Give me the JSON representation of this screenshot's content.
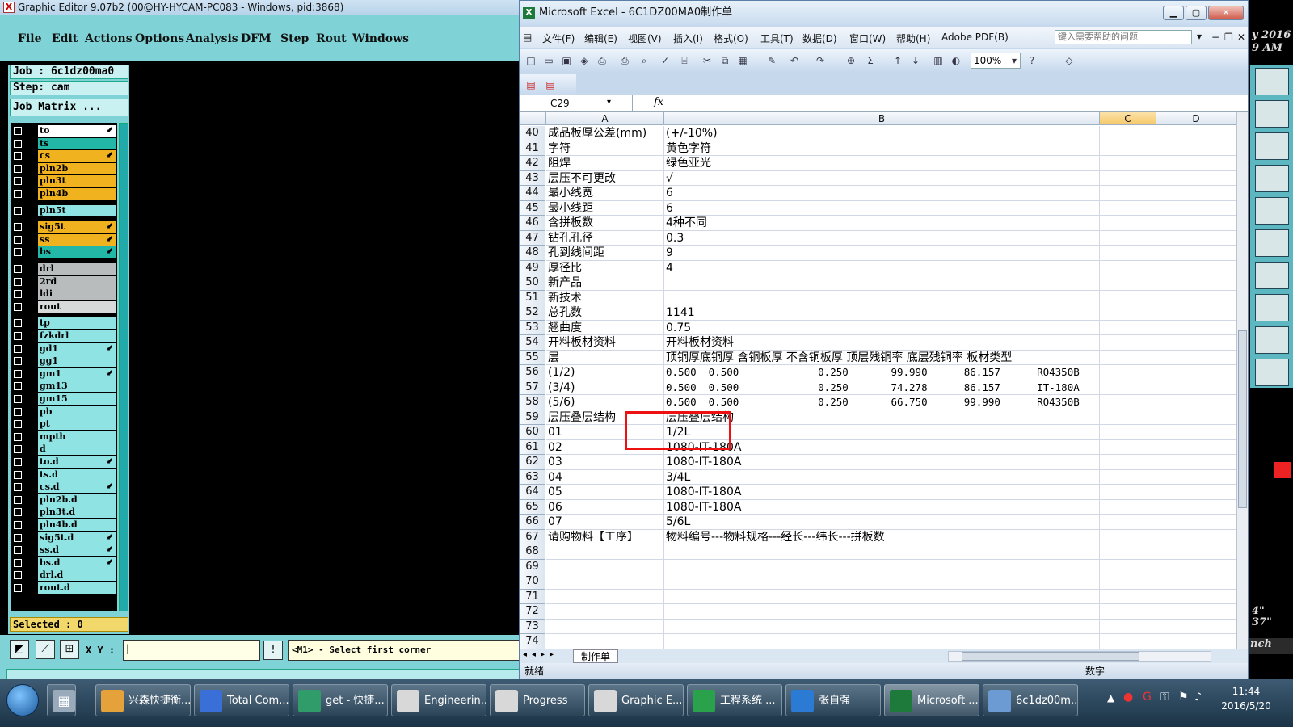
{
  "graphic_editor": {
    "title": "Graphic Editor 9.07b2 (00@HY-HYCAM-PC083 - Windows, pid:3868)",
    "menu": [
      "File",
      "Edit",
      "Actions",
      "Options",
      "Analysis",
      "DFM",
      "Step",
      "Rout",
      "Windows"
    ],
    "job": "Job : 6c1dz00ma0",
    "step": "Step: cam",
    "job_matrix": "Job Matrix ...",
    "layers": [
      {
        "name": "to",
        "color": "#ffffff",
        "arrow": true
      },
      {
        "name": "ts",
        "color": "#23b7a8",
        "arrow": false
      },
      {
        "name": "cs",
        "color": "#f0b21f",
        "arrow": true
      },
      {
        "name": "pln2b",
        "color": "#f0b21f",
        "arrow": false
      },
      {
        "name": "pln3t",
        "color": "#f0b21f",
        "arrow": false
      },
      {
        "name": "pln4b",
        "color": "#f0b21f",
        "arrow": false
      },
      {
        "name": "pln5t",
        "color": "#8fe3e3",
        "arrow": false
      },
      {
        "name": "sig5t",
        "color": "#f0b21f",
        "arrow": true
      },
      {
        "name": "ss",
        "color": "#f0b21f",
        "arrow": true
      },
      {
        "name": "bs",
        "color": "#23b7a8",
        "arrow": true
      },
      {
        "name": "drl",
        "color": "#b8bcbc",
        "arrow": false
      },
      {
        "name": "2rd",
        "color": "#b8bcbc",
        "arrow": false
      },
      {
        "name": "ldi",
        "color": "#b8bcbc",
        "arrow": false
      },
      {
        "name": "rout",
        "color": "#d8dada",
        "arrow": false
      },
      {
        "name": "tp",
        "color": "#8fe3e3",
        "arrow": false
      },
      {
        "name": "fzkdrl",
        "color": "#8fe3e3",
        "arrow": false
      },
      {
        "name": "gd1",
        "color": "#8fe3e3",
        "arrow": true
      },
      {
        "name": "gg1",
        "color": "#8fe3e3",
        "arrow": false
      },
      {
        "name": "gm1",
        "color": "#8fe3e3",
        "arrow": true
      },
      {
        "name": "gm13",
        "color": "#8fe3e3",
        "arrow": false
      },
      {
        "name": "gm15",
        "color": "#8fe3e3",
        "arrow": false
      },
      {
        "name": "pb",
        "color": "#8fe3e3",
        "arrow": false
      },
      {
        "name": "pt",
        "color": "#8fe3e3",
        "arrow": false
      },
      {
        "name": "mpth",
        "color": "#8fe3e3",
        "arrow": false
      },
      {
        "name": "d",
        "color": "#8fe3e3",
        "arrow": false
      },
      {
        "name": "to.d",
        "color": "#8fe3e3",
        "arrow": true
      },
      {
        "name": "ts.d",
        "color": "#8fe3e3",
        "arrow": false
      },
      {
        "name": "cs.d",
        "color": "#8fe3e3",
        "arrow": true
      },
      {
        "name": "pln2b.d",
        "color": "#8fe3e3",
        "arrow": false
      },
      {
        "name": "pln3t.d",
        "color": "#8fe3e3",
        "arrow": false
      },
      {
        "name": "pln4b.d",
        "color": "#8fe3e3",
        "arrow": false
      },
      {
        "name": "sig5t.d",
        "color": "#8fe3e3",
        "arrow": true
      },
      {
        "name": "ss.d",
        "color": "#8fe3e3",
        "arrow": true
      },
      {
        "name": "bs.d",
        "color": "#8fe3e3",
        "arrow": true
      },
      {
        "name": "drl.d",
        "color": "#8fe3e3",
        "arrow": false
      },
      {
        "name": "rout.d",
        "color": "#8fe3e3",
        "arrow": false
      }
    ],
    "selected": "Selected : 0",
    "xy_label": "X Y :",
    "prompt": "<M1> - Select first corner"
  },
  "right_edge": {
    "italic_text": "y 2016\n9 AM",
    "numbers": "4\"\n37\"",
    "inch": "nch"
  },
  "excel": {
    "title": "Microsoft Excel - 6C1DZ00MA0制作单",
    "menu": [
      "文件(F)",
      "编辑(E)",
      "视图(V)",
      "插入(I)",
      "格式(O)",
      "工具(T)",
      "数据(D)",
      "窗口(W)",
      "帮助(H)",
      "Adobe PDF(B)"
    ],
    "help_placeholder": "键入需要帮助的问题",
    "zoom": "100%",
    "name_box": "C29",
    "fx": "fx",
    "columns": [
      "A",
      "B",
      "C",
      "D"
    ],
    "rows": [
      {
        "n": "40",
        "a": "成品板厚公差(mm)",
        "b": "(+/-10%)"
      },
      {
        "n": "41",
        "a": "字符",
        "b": "黄色字符"
      },
      {
        "n": "42",
        "a": "阻焊",
        "b": "绿色亚光"
      },
      {
        "n": "43",
        "a": "层压不可更改",
        "b": "√"
      },
      {
        "n": "44",
        "a": "最小线宽",
        "b": "6"
      },
      {
        "n": "45",
        "a": "最小线距",
        "b": "6"
      },
      {
        "n": "46",
        "a": "含拼板数",
        "b": "4种不同"
      },
      {
        "n": "47",
        "a": "钻孔孔径",
        "b": "0.3"
      },
      {
        "n": "48",
        "a": "孔到线间距",
        "b": "9"
      },
      {
        "n": "49",
        "a": "厚径比",
        "b": "4"
      },
      {
        "n": "50",
        "a": "新产品",
        "b": ""
      },
      {
        "n": "51",
        "a": "新技术",
        "b": ""
      },
      {
        "n": "52",
        "a": "总孔数",
        "b": "1141"
      },
      {
        "n": "53",
        "a": "翘曲度",
        "b": "0.75"
      },
      {
        "n": "54",
        "a": "开料板材资料",
        "b": "开料板材资料"
      },
      {
        "n": "55",
        "a": "层",
        "b": "顶铜厚底铜厚 含铜板厚 不含铜板厚 顶层残铜率 底层残铜率 板材类型"
      },
      {
        "n": "56",
        "a": "(1/2)",
        "b": "0.500  0.500             0.250       99.990      86.157      RO4350B",
        "mono": true
      },
      {
        "n": "57",
        "a": "(3/4)",
        "b": "0.500  0.500             0.250       74.278      86.157      IT-180A",
        "mono": true
      },
      {
        "n": "58",
        "a": "(5/6)",
        "b": "0.500  0.500             0.250       66.750      99.990      RO4350B",
        "mono": true
      },
      {
        "n": "59",
        "a": "层压叠层结构",
        "b": "层压叠层结构"
      },
      {
        "n": "60",
        "a": "01",
        "b": "1/2L"
      },
      {
        "n": "61",
        "a": "02",
        "b": "1080-IT-180A"
      },
      {
        "n": "62",
        "a": "03",
        "b": "1080-IT-180A"
      },
      {
        "n": "63",
        "a": "04",
        "b": "3/4L"
      },
      {
        "n": "64",
        "a": "05",
        "b": "1080-IT-180A"
      },
      {
        "n": "65",
        "a": "06",
        "b": "1080-IT-180A"
      },
      {
        "n": "66",
        "a": "07",
        "b": "5/6L"
      },
      {
        "n": "67",
        "a": "请购物料【工序】",
        "b": "物料编号---物料规格---经长---纬长---拼板数"
      },
      {
        "n": "68",
        "a": "",
        "b": ""
      },
      {
        "n": "69",
        "a": "",
        "b": ""
      },
      {
        "n": "70",
        "a": "",
        "b": ""
      },
      {
        "n": "71",
        "a": "",
        "b": ""
      },
      {
        "n": "72",
        "a": "",
        "b": ""
      },
      {
        "n": "73",
        "a": "",
        "b": ""
      },
      {
        "n": "74",
        "a": "",
        "b": ""
      }
    ],
    "sheet_tab": "制作单",
    "status_ready": "就绪",
    "status_num": "数字"
  },
  "taskbar": {
    "buttons": [
      {
        "label": "兴森快捷衡...",
        "color": "#e5a23b"
      },
      {
        "label": "Total Com...",
        "color": "#3a6fd8"
      },
      {
        "label": "get - 快捷...",
        "color": "#2f9c6a"
      },
      {
        "label": "Engineerin...",
        "color": "#d8d8d8"
      },
      {
        "label": "Progress",
        "color": "#d8d8d8"
      },
      {
        "label": "Graphic E...",
        "color": "#d8d8d8"
      },
      {
        "label": "工程系统 ...",
        "color": "#2aa14b"
      },
      {
        "label": "张自强",
        "color": "#2b7bd4"
      },
      {
        "label": "Microsoft ...",
        "color": "#1d7a3a"
      },
      {
        "label": "6c1dz00m...",
        "color": "#6b9bd2"
      }
    ],
    "time": "11:44",
    "date": "2016/5/20"
  }
}
